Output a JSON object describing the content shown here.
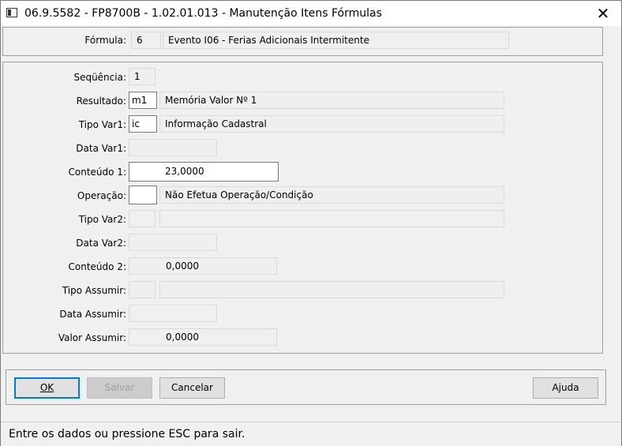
{
  "window": {
    "title": "06.9.5582 - FP8700B - 1.02.01.013 - Manutenção Itens Fórmulas",
    "close_glyph": "✕"
  },
  "header": {
    "formula_label": "Fórmula:",
    "formula_code": "6",
    "formula_desc": "Evento I06 - Ferias Adicionais Intermitente"
  },
  "form": {
    "sequencia_label": "Seqüência:",
    "sequencia_value": "1",
    "resultado_label": "Resultado:",
    "resultado_code": "m1",
    "resultado_desc": "Memória Valor Nº 1",
    "tipovar1_label": "Tipo Var1:",
    "tipovar1_code": "ic",
    "tipovar1_desc": "Informação Cadastral",
    "datavar1_label": "Data Var1:",
    "datavar1_value": "",
    "conteudo1_label": "Conteúdo 1:",
    "conteudo1_value": "23,0000",
    "operacao_label": "Operação:",
    "operacao_code": "",
    "operacao_desc": "Não Efetua Operação/Condição",
    "tipovar2_label": "Tipo Var2:",
    "tipovar2_code": "",
    "tipovar2_desc": "",
    "datavar2_label": "Data Var2:",
    "datavar2_value": "",
    "conteudo2_label": "Conteúdo 2:",
    "conteudo2_value": "0,0000",
    "tipoassumir_label": "Tipo Assumir:",
    "tipoassumir_code": "",
    "tipoassumir_desc": "",
    "dataassumir_label": "Data Assumir:",
    "dataassumir_value": "",
    "valorassumir_label": "Valor Assumir:",
    "valorassumir_value": "0,0000"
  },
  "buttons": {
    "ok": "OK",
    "salvar": "Salvar",
    "cancelar": "Cancelar",
    "ajuda": "Ajuda"
  },
  "status": {
    "text": "Entre os dados ou pressione ESC para sair."
  },
  "colors": {
    "accent": "#0078d7",
    "window_bg": "#f0f0f0"
  }
}
